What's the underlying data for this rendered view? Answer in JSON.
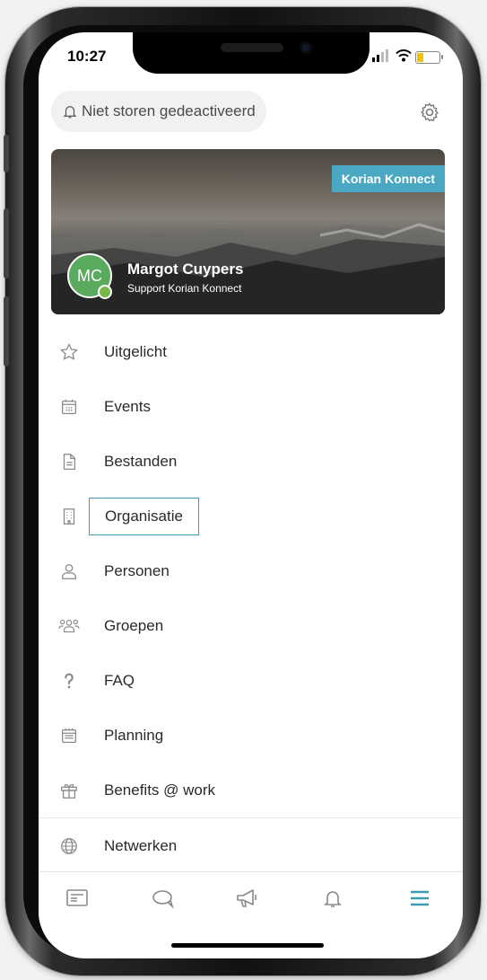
{
  "status_bar": {
    "time": "10:27"
  },
  "dnd": {
    "label": "Niet storen gedeactiveerd",
    "icon": "bell-icon"
  },
  "profile": {
    "tag": "Korian Konnect",
    "initials": "MC",
    "name": "Margot Cuypers",
    "role": "Support Korian Konnect"
  },
  "menu": {
    "items": [
      {
        "label": "Uitgelicht",
        "icon": "star-icon"
      },
      {
        "label": "Events",
        "icon": "calendar-icon"
      },
      {
        "label": "Bestanden",
        "icon": "document-icon"
      },
      {
        "label": "Organisatie",
        "icon": "building-icon",
        "selected": true
      },
      {
        "label": "Personen",
        "icon": "person-icon"
      },
      {
        "label": "Groepen",
        "icon": "group-icon"
      },
      {
        "label": "FAQ",
        "icon": "question-icon"
      },
      {
        "label": "Planning",
        "icon": "planning-icon"
      },
      {
        "label": "Benefits @ work",
        "icon": "gift-icon"
      },
      {
        "label": "Netwerken",
        "icon": "globe-icon"
      }
    ]
  },
  "tabbar": {
    "tabs": [
      {
        "icon": "news-icon",
        "active": false
      },
      {
        "icon": "chat-icon",
        "active": false
      },
      {
        "icon": "megaphone-icon",
        "active": false
      },
      {
        "icon": "bell-icon",
        "active": false
      },
      {
        "icon": "menu-icon",
        "active": true
      }
    ]
  },
  "colors": {
    "accent": "#3b9ab5",
    "tag": "#4aa8c2",
    "avatar": "#5aaa5e",
    "icon": "#8a8a8a"
  }
}
